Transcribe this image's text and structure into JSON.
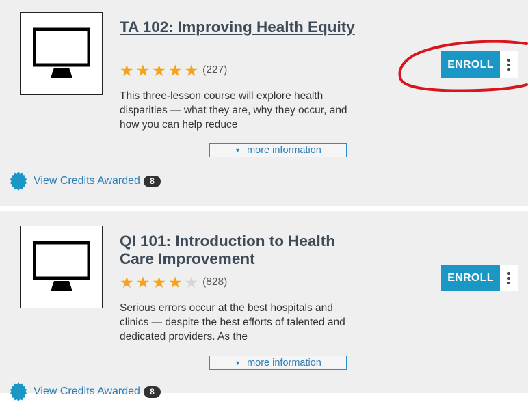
{
  "courses": [
    {
      "title": "TA 102: Improving Health Equity",
      "title_is_link": true,
      "rating_stars": 5,
      "rating_max": 5,
      "rating_count": "(227)",
      "description": "This three-lesson course will explore health disparities — what they are, why they occur, and how you can help reduce",
      "more_label": "more information",
      "enroll_label": "ENROLL",
      "credits_label": "View Credits Awarded",
      "credits_count": "8"
    },
    {
      "title": "QI 101: Introduction to Health Care Improvement",
      "title_is_link": false,
      "rating_stars": 4,
      "rating_max": 5,
      "rating_count": "(828)",
      "description": "Serious errors occur at the best hospitals and clinics — despite the best efforts of talented and dedicated providers. As the",
      "more_label": "more information",
      "enroll_label": "ENROLL",
      "credits_label": "View Credits Awarded",
      "credits_count": "8"
    }
  ],
  "colors": {
    "accent": "#1b97c6",
    "link": "#2a7fb8",
    "star_filled": "#f5a31a",
    "star_empty": "#d6d6d6",
    "card_bg": "#efefef",
    "annotation": "#d8141c"
  },
  "icons": {
    "thumbnail": "computer-monitor-icon",
    "credits": "seal-badge-icon",
    "more_toggle": "caret-down-icon",
    "menu": "vertical-ellipsis-icon"
  }
}
